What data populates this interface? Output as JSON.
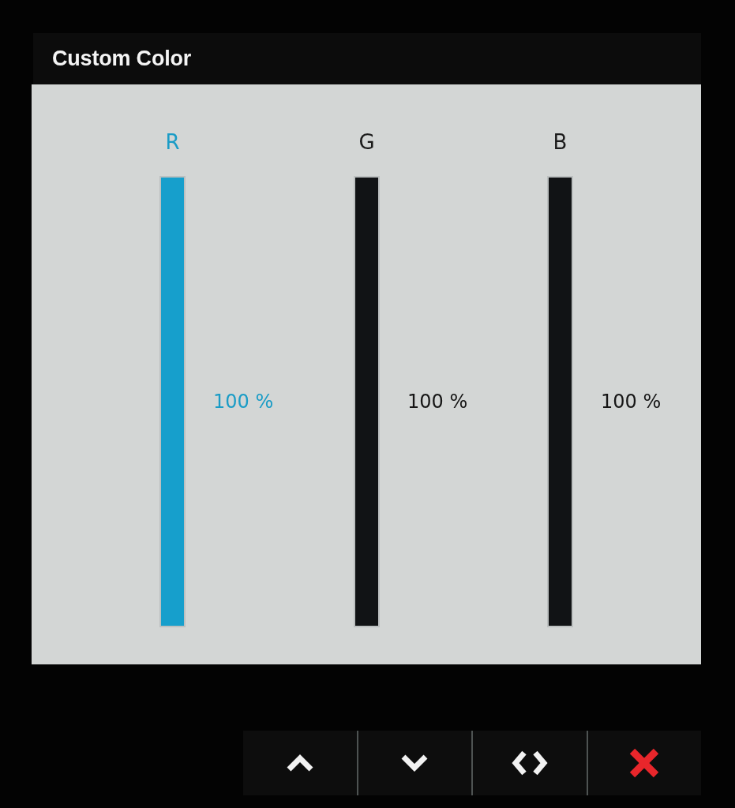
{
  "window": {
    "title": "Custom Color"
  },
  "channels": [
    {
      "name": "R",
      "selected": true,
      "level": 1,
      "reading": "100 %"
    },
    {
      "name": "G",
      "selected": false,
      "level": 1,
      "reading": "100 %"
    },
    {
      "name": "B",
      "selected": false,
      "level": 1,
      "reading": "100 %"
    }
  ],
  "buttons": [
    {
      "kind": "up"
    },
    {
      "kind": "down"
    },
    {
      "kind": "swap"
    },
    {
      "kind": "close"
    }
  ]
}
